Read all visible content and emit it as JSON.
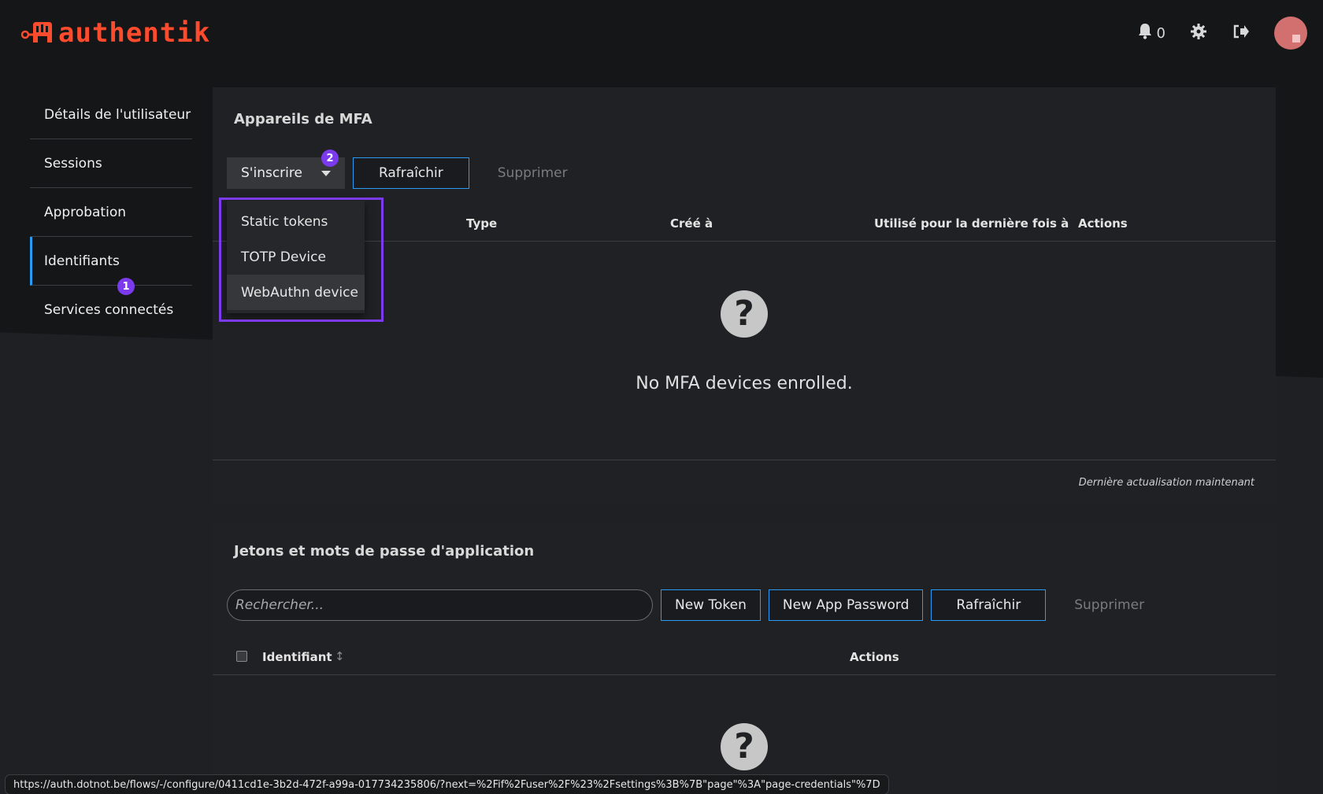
{
  "brand": {
    "name": "authentik",
    "color": "#fd4b2d"
  },
  "header": {
    "notification_count": "0",
    "icons": [
      "bell-icon",
      "gear-icon",
      "logout-icon",
      "avatar"
    ]
  },
  "sidebar": {
    "items": [
      {
        "label": "Détails de l'utilisateur"
      },
      {
        "label": "Sessions"
      },
      {
        "label": "Approbation"
      },
      {
        "label": "Identifiants",
        "active": true,
        "badge": "1"
      },
      {
        "label": "Services connectés"
      }
    ]
  },
  "mfa": {
    "title": "Appareils de MFA",
    "enroll_label": "S'inscrire",
    "enroll_badge": "2",
    "refresh_label": "Rafraîchir",
    "delete_label": "Supprimer",
    "dropdown": [
      "Static tokens",
      "TOTP Device",
      "WebAuthn device"
    ],
    "columns": [
      "Type",
      "Créé à",
      "Utilisé pour la dernière fois à",
      "Actions"
    ],
    "empty_text": "No MFA devices enrolled.",
    "footer": "Dernière actualisation maintenant"
  },
  "tokens": {
    "title": "Jetons et mots de passe d'application",
    "search_placeholder": "Rechercher...",
    "new_token_label": "New Token",
    "new_app_password_label": "New App Password",
    "refresh_label": "Rafraîchir",
    "delete_label": "Supprimer",
    "columns": [
      "Identifiant",
      "Actions"
    ]
  },
  "statusbar": {
    "url": "https://auth.dotnot.be/flows/-/configure/0411cd1e-3b2d-472f-a99a-017734235806/?next=%2Fif%2Fuser%2F%23%2Fsettings%3B%7B\"page\"%3A\"page-credentials\"%7D"
  },
  "colors": {
    "accent": "#2b9af3",
    "highlight": "#7c3aed"
  }
}
